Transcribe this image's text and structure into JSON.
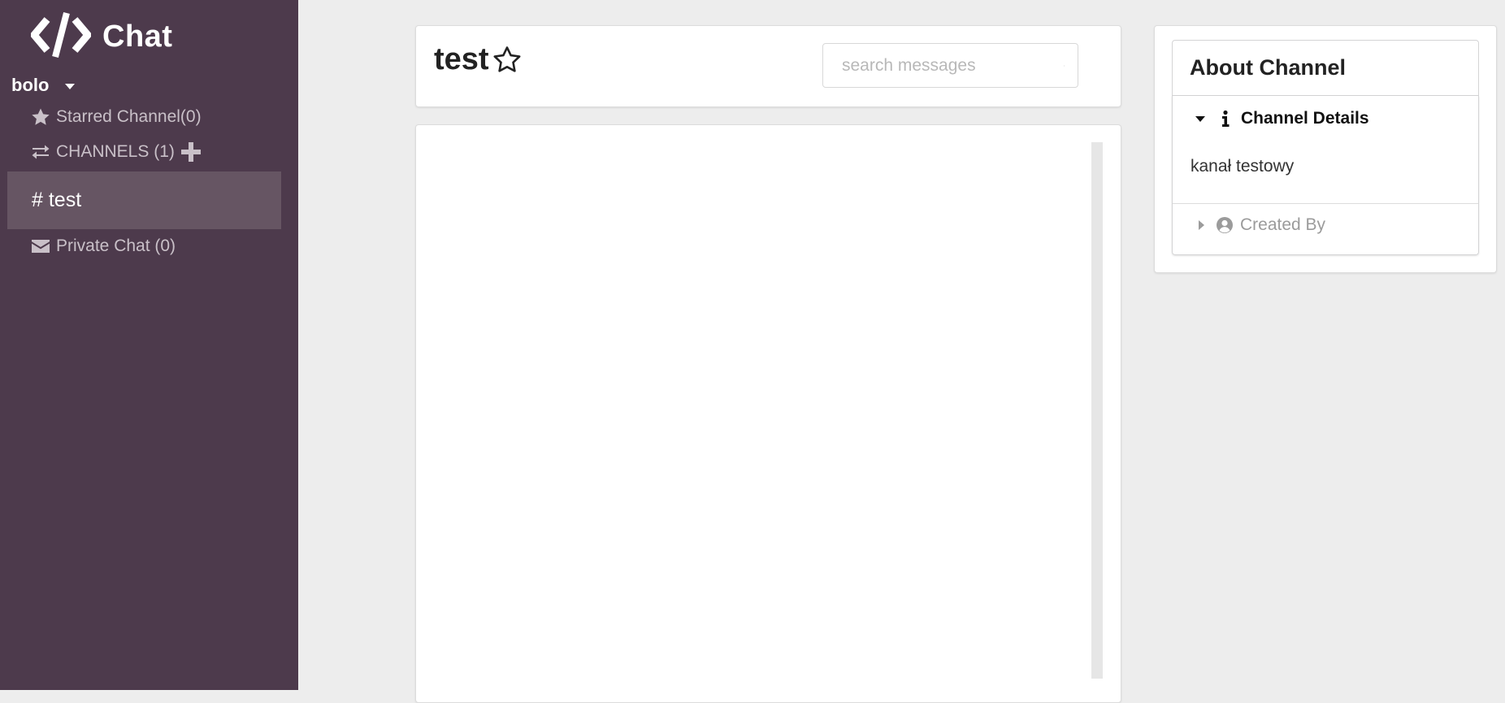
{
  "sidebar": {
    "app_title": "Chat",
    "user_name": "bolo",
    "starred_label": "Starred Channel(0)",
    "channels_label": "CHANNELS (1)",
    "active_channel": "# test",
    "private_chat_label": "Private Chat (0)"
  },
  "header": {
    "channel_name": "test",
    "search_placeholder": "search messages",
    "search_value": ""
  },
  "about": {
    "title": "About Channel",
    "details_title": "Channel Details",
    "details_content": "kanał testowy",
    "created_by_title": "Created By"
  },
  "colors": {
    "sidebar_bg": "#4d3a4c",
    "active_item_bg": "#665563",
    "page_bg": "#ededed"
  },
  "icons": {
    "brand": "code-icon",
    "user_menu": "caret-down-icon",
    "starred": "star-icon",
    "channels": "exchange-icon",
    "add_channel": "plus-icon",
    "private_chat": "mail-icon",
    "favorite": "star-outline-icon",
    "search": "search-icon",
    "details": "info-icon",
    "created_by": "user-circle-icon"
  }
}
